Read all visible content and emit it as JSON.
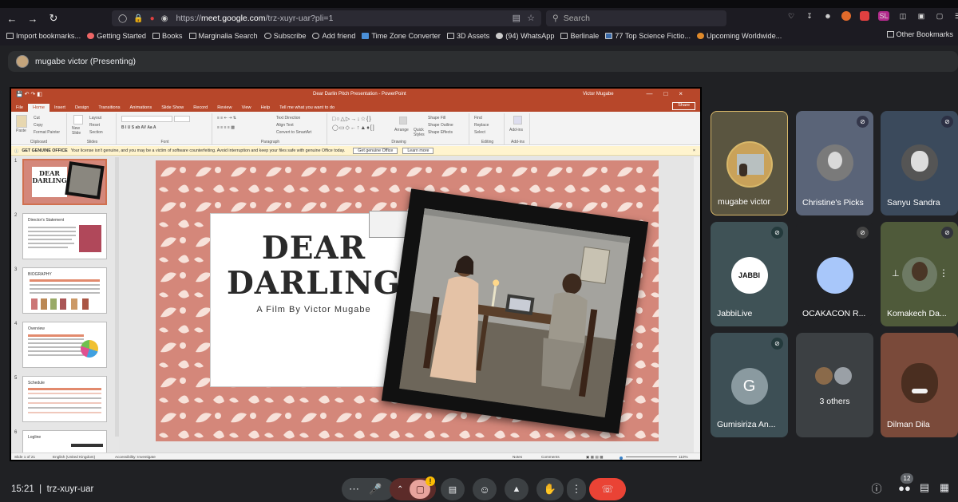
{
  "browser": {
    "url_prefix": "https://",
    "url_domain": "meet.google.com",
    "url_path": "/trz-xuyr-uar?pli=1",
    "search_placeholder": "Search",
    "bookmarks": [
      "Import bookmarks...",
      "Getting Started",
      "Books",
      "Marginalia Search",
      "Subscribe",
      "Add friend",
      "Time Zone Converter",
      "3D Assets",
      "(94) WhatsApp",
      "Berlinale",
      "77 Top Science Fictio...",
      "Upcoming Worldwide..."
    ],
    "other_bookmarks": "Other Bookmarks"
  },
  "meet": {
    "presenting_label": "mugabe victor (Presenting)",
    "time": "15:21",
    "divider": "|",
    "meeting_code": "trz-xuyr-uar",
    "participants_count": "12",
    "participants": [
      {
        "name": "mugabe victor",
        "muted": false,
        "type": "video"
      },
      {
        "name": "Christine's Picks",
        "muted": true,
        "type": "photo"
      },
      {
        "name": "Sanyu Sandra",
        "muted": true,
        "type": "photo"
      },
      {
        "name": "JabbiLive",
        "muted": true,
        "type": "logo"
      },
      {
        "name": "OCAKACON R...",
        "muted": true,
        "type": "blank"
      },
      {
        "name": "Komakech Da...",
        "muted": true,
        "type": "photo"
      },
      {
        "name": "Gumisiriza An...",
        "muted": true,
        "type": "letter",
        "letter": "G"
      },
      {
        "name": "3 others",
        "muted": false,
        "type": "group"
      },
      {
        "name": "Dilman Dila",
        "muted": false,
        "type": "video"
      }
    ],
    "jabbi_logo_text": "JABBI",
    "colors": {
      "end_call": "#ea4335",
      "tile_bg": "#3c4043",
      "page_bg": "#202124"
    }
  },
  "ppt": {
    "title": "Dear Darlin Pitch Presentation  -  PowerPoint",
    "user": "Victor Mugabe",
    "menu": [
      "File",
      "Home",
      "Insert",
      "Design",
      "Transitions",
      "Animations",
      "Slide Show",
      "Record",
      "Review",
      "View",
      "Help",
      "Tell me what you want to do"
    ],
    "share": "Share",
    "ribbon": {
      "clipboard": {
        "label": "Clipboard",
        "paste": "Paste",
        "cut": "Cut",
        "copy": "Copy",
        "painter": "Format Painter"
      },
      "slides": {
        "label": "Slides",
        "new": "New Slide",
        "layout": "Layout",
        "reset": "Reset",
        "section": "Section"
      },
      "font": {
        "label": "Font"
      },
      "paragraph": {
        "label": "Paragraph",
        "dir": "Text Direction",
        "align": "Align Text",
        "smart": "Convert to SmartArt"
      },
      "drawing": {
        "label": "Drawing",
        "arrange": "Arrange",
        "quick": "Quick Styles",
        "fill": "Shape Fill",
        "outline": "Shape Outline",
        "effects": "Shape Effects"
      },
      "editing": {
        "label": "Editing",
        "find": "Find",
        "replace": "Replace",
        "select": "Select"
      },
      "addins": {
        "label": "Add-ins",
        "btn": "Add-ins"
      }
    },
    "warning": {
      "bold": "GET GENUINE OFFICE",
      "text": "Your license isn't genuine, and you may be a victim of software counterfeiting. Avoid interruption and keep your files safe with genuine Office today.",
      "btn1": "Get genuine Office",
      "btn2": "Learn more"
    },
    "thumbnails": [
      {
        "num": "1",
        "title": ""
      },
      {
        "num": "2",
        "title": "Director's Statement"
      },
      {
        "num": "3",
        "title": "BIOGRAPHY"
      },
      {
        "num": "4",
        "title": "Overview"
      },
      {
        "num": "5",
        "title": "Schedule"
      },
      {
        "num": "6",
        "title": "Logline"
      }
    ],
    "thumb1": {
      "line1": "DEAR",
      "line2": "DARLING"
    },
    "slide": {
      "title_line1": "DEAR",
      "title_line2": "DARLING",
      "subtitle": "A Film By Victor Mugabe",
      "bg_color": "#d4877a"
    },
    "status": {
      "slide": "Slide 1 of 21",
      "language": "English (United Kingdom)",
      "accessibility": "Accessibility: Investigate",
      "notes": "Notes",
      "comments": "Comments",
      "zoom": "110%"
    }
  }
}
